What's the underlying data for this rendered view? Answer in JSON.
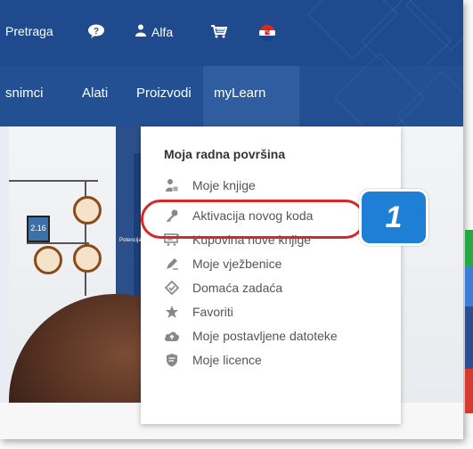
{
  "topbar": {
    "search_label": "Pretraga",
    "user_label": "Alfa",
    "help_icon": "help-bubble-icon",
    "user_icon": "user-icon",
    "cart_icon": "cart-icon",
    "flag_icon": "croatia-flag-icon"
  },
  "navbar": {
    "items": [
      {
        "label": "snimci"
      },
      {
        "label": "Alati"
      },
      {
        "label": "Proizvodi"
      },
      {
        "label": "myLearn"
      }
    ],
    "active": "myLearn"
  },
  "menu": {
    "title": "Moja radna površina",
    "items": [
      {
        "label": "Moje knjige",
        "icon": "book-reader-icon"
      },
      {
        "label": "Aktivacija novog koda",
        "icon": "key-icon"
      },
      {
        "label": "Kupovina nove knjige",
        "icon": "cart-book-icon"
      },
      {
        "label": "Moje vježbenice",
        "icon": "workbook-icon"
      },
      {
        "label": "Domaća zadaća",
        "icon": "homework-icon"
      },
      {
        "label": "Favoriti",
        "icon": "star-icon"
      },
      {
        "label": "Moje postavljene datoteke",
        "icon": "cloud-upload-icon"
      },
      {
        "label": "Moje licence",
        "icon": "license-shield-icon"
      }
    ]
  },
  "annotation": {
    "step_number": "1"
  },
  "simulation": {
    "meter_value": "2.16",
    "slider_label": "Potencijal"
  },
  "colors": {
    "topbar": "#1f4b8e",
    "navbar": "#234f93",
    "highlight": "#d62828",
    "badge": "#1e7fd6"
  }
}
